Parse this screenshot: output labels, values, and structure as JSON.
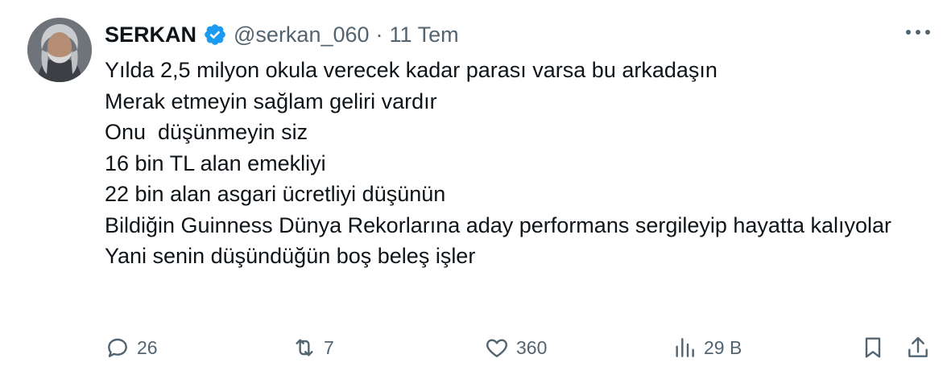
{
  "tweet": {
    "author_name": "SERKAN",
    "handle": "@serkan_060",
    "separator": "·",
    "time": "11 Tem",
    "lines": [
      "Yılda 2,5 milyon okula verecek kadar parası varsa bu arkadaşın",
      "Merak etmeyin sağlam geliri vardır",
      "Onu  düşünmeyin siz",
      "16 bin TL alan emekliyi",
      "22 bin alan asgari ücretliyi düşünün",
      "Bildiğin Guinness Dünya Rekorlarına aday performans sergileyip hayatta kalıyolar",
      "Yani senin düşündüğün boş beleş işler"
    ]
  },
  "actions": {
    "reply_count": "26",
    "retweet_count": "7",
    "like_count": "360",
    "views_count": "29 B"
  },
  "icons": [
    "verified-badge-icon",
    "more-icon",
    "reply-icon",
    "retweet-icon",
    "like-icon",
    "views-icon",
    "bookmark-icon",
    "share-icon"
  ],
  "colors": {
    "verified": "#1d9bf0",
    "muted": "#536471",
    "text": "#0f1419"
  }
}
